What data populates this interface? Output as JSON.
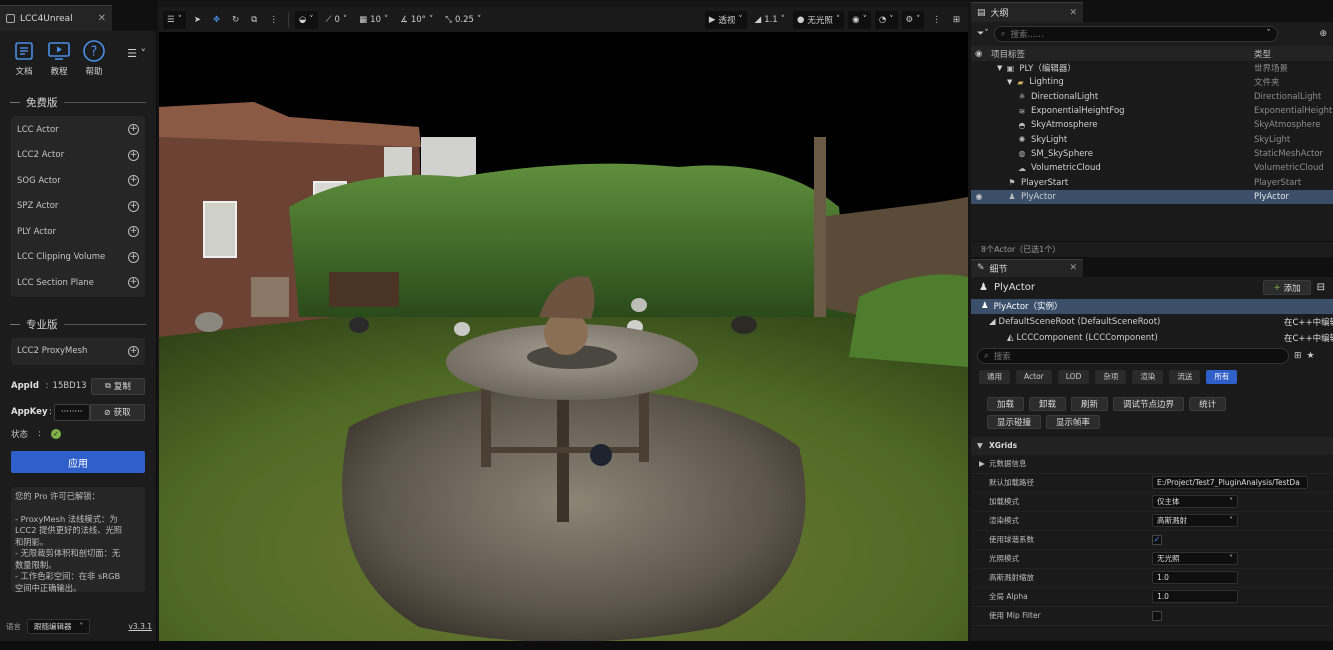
{
  "left_panel": {
    "tab_title": "LCC4Unreal",
    "icons": [
      {
        "label": "文档",
        "icon": "document-icon"
      },
      {
        "label": "教程",
        "icon": "tutorial-icon"
      },
      {
        "label": "帮助",
        "icon": "help-icon"
      }
    ],
    "free_section_title": "免费版",
    "free_items": [
      "LCC Actor",
      "LCC2 Actor",
      "SOG Actor",
      "SPZ Actor",
      "PLY Actor",
      "LCC Clipping Volume",
      "LCC Section Plane"
    ],
    "pro_section_title": "专业版",
    "pro_items": [
      "LCC2 ProxyMesh"
    ],
    "appid_label": "AppId",
    "appid_value": "15BD13",
    "copy_label": "复制",
    "appkey_label": "AppKey",
    "appkey_value": "········",
    "fetch_label": "获取",
    "status_label": "状态",
    "status_colon": ":",
    "apply_label": "应用",
    "info_lines": [
      "您的 Pro 许可已解锁：",
      "",
      "- ProxyMesh 法线模式：为",
      "LCC2 提供更好的法线、光照",
      "和阴影。",
      "- 无限裁剪体积和剖切面：无",
      "数量限制。",
      "- 工作色彩空间：在非 sRGB",
      "空间中正确输出。"
    ],
    "language_label": "语言",
    "language_value": "跟随编辑器",
    "version": "v3.3.1"
  },
  "viewport": {
    "view_mode": "透视",
    "lighting_mode": "无光照",
    "snap_angle": "0",
    "grid_size": "10",
    "rotation_snap": "10°",
    "scale_snap": "0.25",
    "camera_speed": "1.1"
  },
  "outliner": {
    "tab_title": "大纲",
    "search_placeholder": "搜索......",
    "col_label": "项目标签",
    "col_type": "类型",
    "rows": [
      {
        "label": "PLY（编辑器）",
        "type": "世界场景",
        "icon": "level-icon",
        "indent": 1
      },
      {
        "label": "Lighting",
        "type": "文件夹",
        "icon": "folder-icon",
        "indent": 2
      },
      {
        "label": "DirectionalLight",
        "type": "DirectionalLight",
        "icon": "sun-icon",
        "indent": 3
      },
      {
        "label": "ExponentialHeightFog",
        "type": "ExponentialHeightFog",
        "icon": "fog-icon",
        "indent": 3
      },
      {
        "label": "SkyAtmosphere",
        "type": "SkyAtmosphere",
        "icon": "atmosphere-icon",
        "indent": 3
      },
      {
        "label": "SkyLight",
        "type": "SkyLight",
        "icon": "skylight-icon",
        "indent": 3
      },
      {
        "label": "SM_SkySphere",
        "type": "StaticMeshActor",
        "icon": "sphere-icon",
        "indent": 3
      },
      {
        "label": "VolumetricCloud",
        "type": "VolumetricCloud",
        "icon": "cloud-icon",
        "indent": 3
      },
      {
        "label": "PlayerStart",
        "type": "PlayerStart",
        "icon": "player-icon",
        "indent": 2
      },
      {
        "label": "PlyActor",
        "type": "PlyActor",
        "icon": "actor-icon",
        "indent": 2,
        "selected": true
      }
    ],
    "status": "8个Actor（已选1个）"
  },
  "details": {
    "tab_title": "细节",
    "actor_name": "PlyActor",
    "add_label": "添加",
    "component_root": "PlyActor（实例）",
    "scene_root": "DefaultSceneRoot (DefaultSceneRoot)",
    "scene_root_note": "在C++中编辑",
    "lcc_component": "LCCComponent (LCCComponent)",
    "lcc_component_note": "在C++中编辑",
    "search_placeholder": "搜索",
    "filters": [
      "通用",
      "Actor",
      "LOD",
      "杂项",
      "渲染",
      "流送",
      "所有"
    ],
    "buttons_row1": [
      "加载",
      "卸载",
      "刷新",
      "调试节点边界",
      "统计"
    ],
    "buttons_row2": [
      "显示碰撞",
      "显示帧率"
    ],
    "category": "XGrids",
    "metadata": "元数据信息",
    "props": [
      {
        "label": "默认加载路径",
        "value": "E:/Project/Test7_PluginAnalysis/TestDa"
      },
      {
        "label": "加载模式",
        "value": "仅主体"
      },
      {
        "label": "渲染模式",
        "value": "高斯溅射"
      },
      {
        "label": "使用球谐系数",
        "value": ""
      },
      {
        "label": "光照模式",
        "value": "无光照"
      },
      {
        "label": "高斯溅射缩放",
        "value": "1.0"
      },
      {
        "label": "全局 Alpha",
        "value": "1.0"
      },
      {
        "label": "使用 Mip Filter",
        "value": ""
      }
    ]
  },
  "colors": {
    "accent": "#2f5fc8",
    "status_ok": "#7fb14a",
    "selection": "#3b4f6b"
  }
}
